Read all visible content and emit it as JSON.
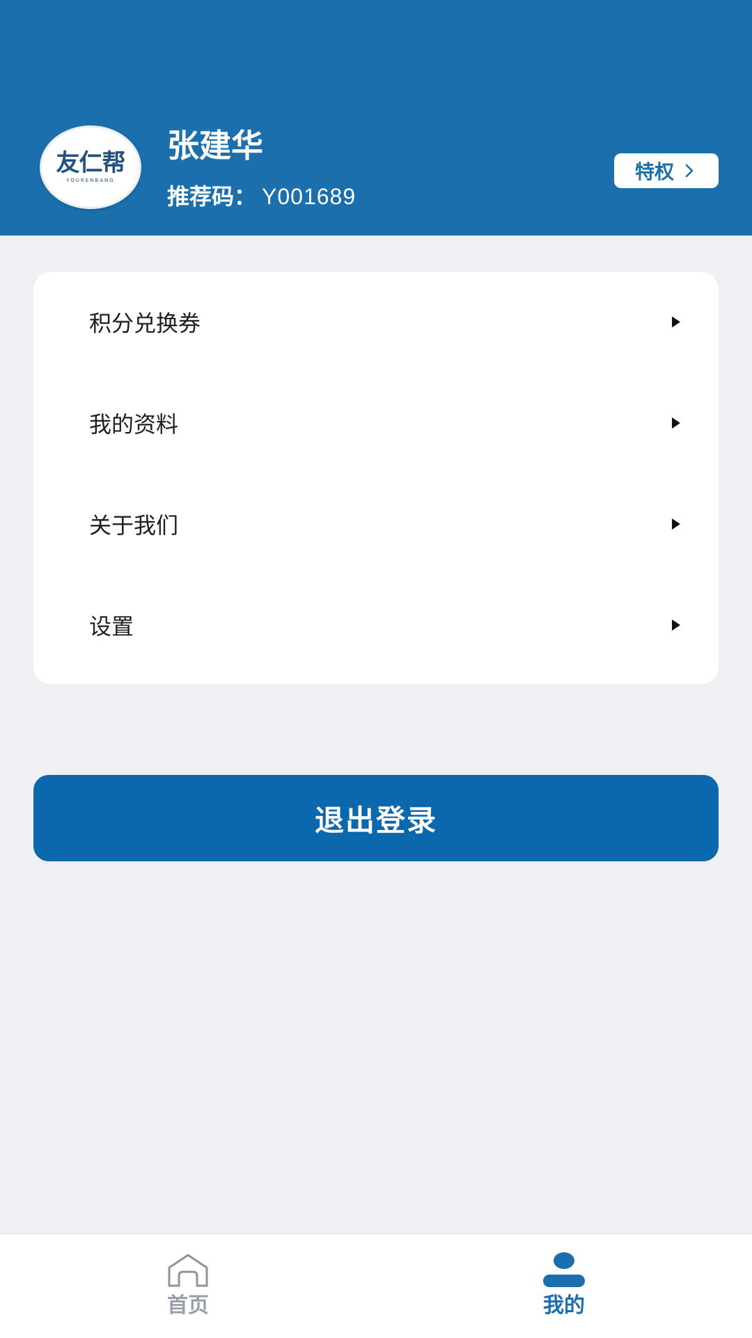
{
  "header": {
    "avatar_logo_text": "友仁帮",
    "avatar_logo_subtext": "YOURENBANG",
    "user_name": "张建华",
    "referral_label": "推荐码：",
    "referral_code": "Y001689",
    "privilege_label": "特权",
    "background_color": "#1b6fad"
  },
  "menu": {
    "items": [
      {
        "label": "积分兑换券",
        "icon": "caret-right-icon"
      },
      {
        "label": "我的资料",
        "icon": "caret-right-icon"
      },
      {
        "label": "关于我们",
        "icon": "caret-right-icon"
      },
      {
        "label": "设置",
        "icon": "caret-right-icon"
      }
    ]
  },
  "logout": {
    "label": "退出登录",
    "color": "#0c68ad"
  },
  "bottom_nav": {
    "items": [
      {
        "label": "首页",
        "icon": "home-icon",
        "active": false
      },
      {
        "label": "我的",
        "icon": "person-icon",
        "active": true
      }
    ],
    "active_color": "#1b6fad",
    "inactive_color": "#9aa0a8"
  }
}
